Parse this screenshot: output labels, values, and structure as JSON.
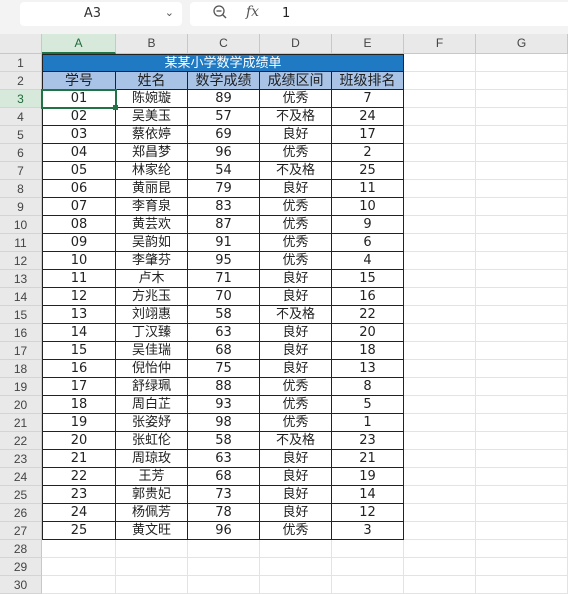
{
  "formula_bar": {
    "name_box": "A3",
    "fx_label": "fx",
    "value": "1"
  },
  "columns": [
    "A",
    "B",
    "C",
    "D",
    "E",
    "F",
    "G"
  ],
  "rows": [
    "1",
    "2",
    "3",
    "4",
    "5",
    "6",
    "7",
    "8",
    "9",
    "10",
    "11",
    "12",
    "13",
    "14",
    "15",
    "16",
    "17",
    "18",
    "19",
    "20",
    "21",
    "22",
    "23",
    "24",
    "25",
    "26",
    "27",
    "28",
    "29",
    "30"
  ],
  "sheet": {
    "title": "某某小学数学成绩单",
    "headers": [
      "学号",
      "姓名",
      "数学成绩",
      "成绩区间",
      "班级排名"
    ],
    "records": [
      [
        "01",
        "陈婉璇",
        "89",
        "优秀",
        "7"
      ],
      [
        "02",
        "吴美玉",
        "57",
        "不及格",
        "24"
      ],
      [
        "03",
        "蔡依婷",
        "69",
        "良好",
        "17"
      ],
      [
        "04",
        "郑昌梦",
        "96",
        "优秀",
        "2"
      ],
      [
        "05",
        "林家纶",
        "54",
        "不及格",
        "25"
      ],
      [
        "06",
        "黄丽昆",
        "79",
        "良好",
        "11"
      ],
      [
        "07",
        "李育泉",
        "83",
        "优秀",
        "10"
      ],
      [
        "08",
        "黄芸欢",
        "87",
        "优秀",
        "9"
      ],
      [
        "09",
        "吴韵如",
        "91",
        "优秀",
        "6"
      ],
      [
        "10",
        "李肇芬",
        "95",
        "优秀",
        "4"
      ],
      [
        "11",
        "卢木",
        "71",
        "良好",
        "15"
      ],
      [
        "12",
        "方兆玉",
        "70",
        "良好",
        "16"
      ],
      [
        "13",
        "刘翊惠",
        "58",
        "不及格",
        "22"
      ],
      [
        "14",
        "丁汉臻",
        "63",
        "良好",
        "20"
      ],
      [
        "15",
        "吴佳瑞",
        "68",
        "良好",
        "18"
      ],
      [
        "16",
        "倪怡仲",
        "75",
        "良好",
        "13"
      ],
      [
        "17",
        "舒绿珮",
        "88",
        "优秀",
        "8"
      ],
      [
        "18",
        "周白芷",
        "93",
        "优秀",
        "5"
      ],
      [
        "19",
        "张姿妤",
        "98",
        "优秀",
        "1"
      ],
      [
        "20",
        "张虹伦",
        "58",
        "不及格",
        "23"
      ],
      [
        "21",
        "周琼玫",
        "63",
        "良好",
        "21"
      ],
      [
        "22",
        "王芳",
        "68",
        "良好",
        "19"
      ],
      [
        "23",
        "郭贵妃",
        "73",
        "良好",
        "14"
      ],
      [
        "24",
        "杨佩芳",
        "78",
        "良好",
        "12"
      ],
      [
        "25",
        "黄文旺",
        "96",
        "优秀",
        "3"
      ]
    ]
  },
  "active_cell": "A3",
  "colors": {
    "title_fill": "#1f7ac3",
    "header_fill": "#a8c3e6",
    "selection": "#217346"
  },
  "icons": {
    "zoom": "zoom-icon",
    "dropdown": "chevron-down-icon"
  }
}
